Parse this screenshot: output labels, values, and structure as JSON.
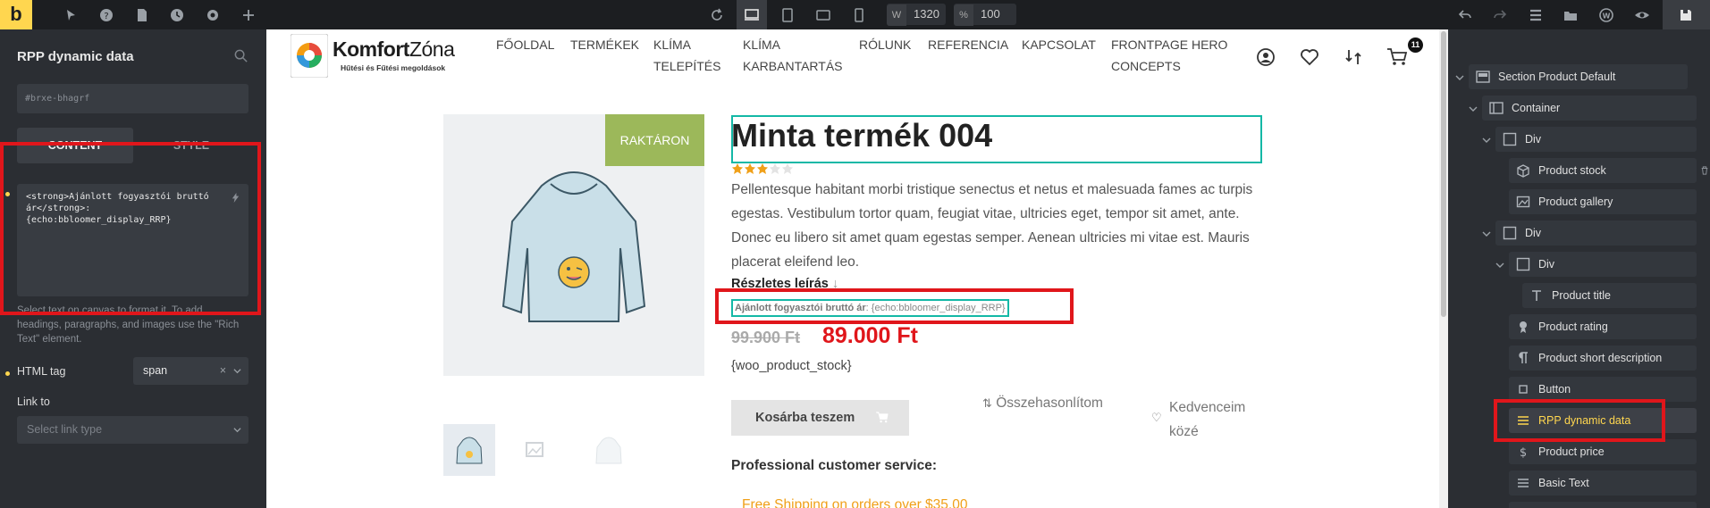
{
  "topbar": {
    "logo": "b",
    "width_value": "1320",
    "width_prefix": "W",
    "zoom_value": "100",
    "zoom_prefix": "%"
  },
  "left": {
    "title": "RPP dynamic data",
    "element_id": "#brxe-bhagrf",
    "tab_content": "CONTENT",
    "tab_style": "STYLE",
    "code_line1": "<strong>Ajánlott fogyasztói bruttó",
    "code_line2": "ár</strong>:",
    "code_line3": "{echo:bbloomer_display_RRP}",
    "hint": "Select text on canvas to format it. To add headings, paragraphs, and images use the \"Rich Text\" element.",
    "html_tag_label": "HTML tag",
    "html_tag_value": "span",
    "link_label": "Link to",
    "link_placeholder": "Select link type"
  },
  "site": {
    "brand1": "Komfort",
    "brand2": "Zóna",
    "tagline": "Hűtési és Fűtési megoldások",
    "nav": [
      "FŐOLDAL",
      "TERMÉKEK",
      "KLÍMA",
      "TELEPÍTÉS",
      "KLÍMA",
      "KARBANTARTÁS",
      "RÓLUNK",
      "REFERENCIA",
      "KAPCSOLAT",
      "FRONTPAGE HERO",
      "CONCEPTS"
    ],
    "cart_count": "11"
  },
  "product": {
    "badge": "RAKTÁRON",
    "title": "Minta termék 004",
    "rating": 3,
    "rating_max": 5,
    "desc": "Pellentesque habitant morbi tristique senectus et netus et malesuada fames ac turpis egestas. Vestibulum tortor quam, feugiat vitae, ultricies eget, tempor sit amet, ante. Donec eu libero sit amet quam egestas semper. Aenean ultricies mi vitae est. Mauris placerat eleifend leo.",
    "more_link": "Részletes leírás",
    "rrp_label": "Ajánlott fogyasztói bruttó ár",
    "rrp_value": ": {echo:bbloomer_display_RRP}",
    "old_price": "99.900 Ft",
    "new_price": "89.000 Ft",
    "stock_tag": "{woo_product_stock}",
    "add_to_cart": "Kosárba teszem",
    "compare": "Összehasonlítom",
    "wishlist1": "Kedvenceim",
    "wishlist2": "közé",
    "service": "Professional customer service:",
    "free_shipping": "Free Shipping on orders over $35.00"
  },
  "tree": [
    "Section Product Default",
    "Container",
    "Div",
    "Product stock",
    "Product gallery",
    "Div",
    "Div",
    "Product title",
    "Product rating",
    "Product short description",
    "Button",
    "RPP dynamic data",
    "Product price",
    "Basic Text"
  ],
  "colors": {
    "accent": "#ffd64f",
    "highlight": "#e0161b",
    "badge": "#9cb85a",
    "price": "#e0161b",
    "teal": "#14b8a6"
  }
}
